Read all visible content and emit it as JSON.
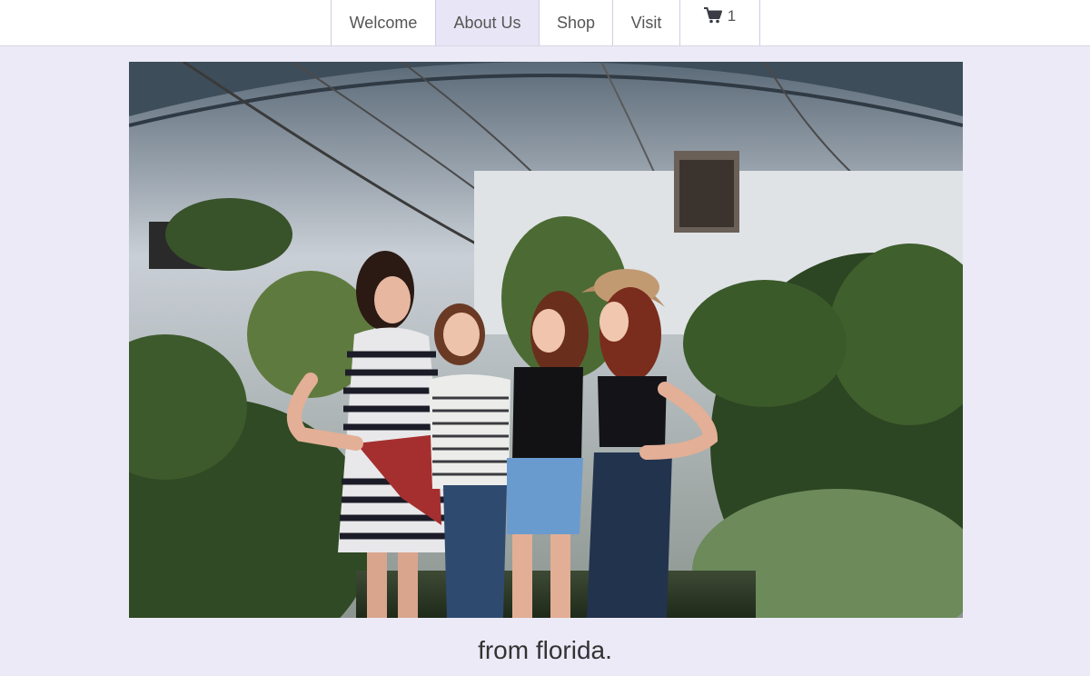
{
  "nav": {
    "items": [
      {
        "label": "Welcome",
        "active": false
      },
      {
        "label": "About Us",
        "active": true
      },
      {
        "label": "Shop",
        "active": false
      },
      {
        "label": "Visit",
        "active": false
      }
    ],
    "cart": {
      "icon": "cart-icon",
      "count": "1"
    }
  },
  "hero": {
    "image_subject": "four-women-laughing-in-greenhouse-photo"
  },
  "caption": "from florida.",
  "colors": {
    "page_background": "#eceaf7",
    "nav_active": "#e8e6f6",
    "text": "#333333"
  }
}
